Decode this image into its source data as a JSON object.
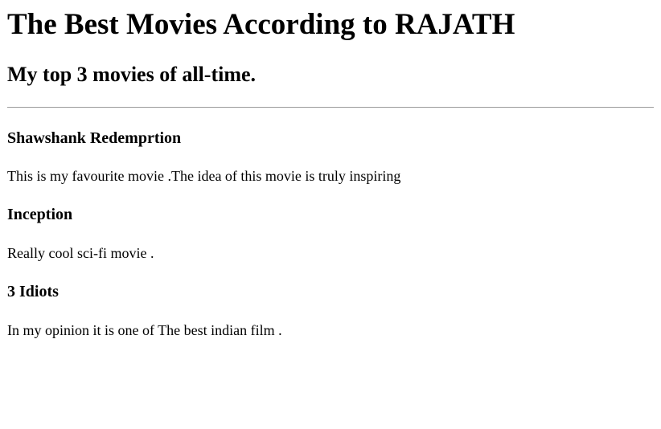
{
  "header": {
    "title": "The Best Movies According to RAJATH",
    "subtitle": "My top 3 movies of all-time."
  },
  "movies": [
    {
      "title": "Shawshank Redemprtion",
      "description": "This is my favourite movie .The idea of this movie is truly inspiring"
    },
    {
      "title": "Inception",
      "description": "Really cool sci-fi movie ."
    },
    {
      "title": "3 Idiots",
      "description": "In my opinion it is one of The best indian film ."
    }
  ],
  "colors": {
    "text": "#000000",
    "background": "#ffffff",
    "divider": "#9a9a9a"
  }
}
